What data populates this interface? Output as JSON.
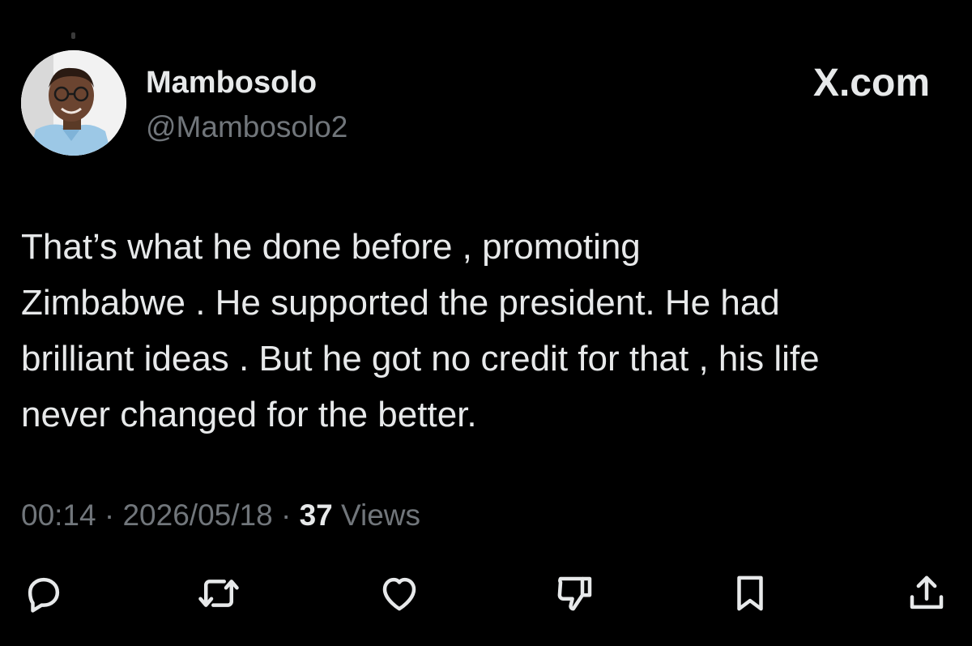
{
  "header": {
    "display_name": "Mambosolo",
    "handle": "@Mambosolo2",
    "brand": "X.com"
  },
  "tweet": {
    "text": "That’s  what he done before , promoting\nZimbabwe . He supported the president. He had\nbrilliant ideas . But he got no credit for that , his life\nnever changed for the better."
  },
  "meta": {
    "time": "00:14",
    "separator": "·",
    "date": "2026/05/18",
    "views_count": "37",
    "views_label": "Views"
  },
  "actions": {
    "icons": [
      "reply-icon",
      "retweet-icon",
      "like-icon",
      "dislike-icon",
      "bookmark-icon",
      "share-icon"
    ]
  },
  "colors": {
    "background": "#000000",
    "primary_text": "#e7e9ea",
    "secondary_text": "#71767b"
  }
}
